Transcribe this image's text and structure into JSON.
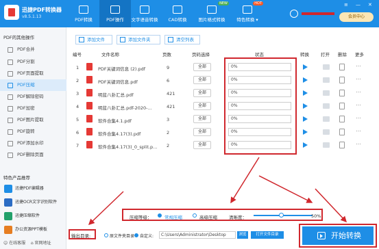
{
  "app": {
    "title": "迅捷PDF转换器",
    "version": "v8.5.1.13"
  },
  "tabs": [
    {
      "label": "PDF转换",
      "icon": "pdf-convert-icon",
      "active": false
    },
    {
      "label": "PDF操作",
      "icon": "pdf-operate-icon",
      "active": true
    },
    {
      "label": "文字语音转换",
      "icon": "text-voice-icon",
      "active": false
    },
    {
      "label": "CAD转换",
      "icon": "cad-icon",
      "active": false
    },
    {
      "label": "图片格式转换",
      "icon": "image-format-icon",
      "active": false,
      "badge": "NEW"
    },
    {
      "label": "特色转换",
      "icon": "feature-icon",
      "active": false,
      "badge": "HOT"
    }
  ],
  "header": {
    "member_label": "会员中心"
  },
  "sidebar": {
    "heading": "PDF的其他操作",
    "items": [
      {
        "label": "PDF合并"
      },
      {
        "label": "PDF分割"
      },
      {
        "label": "PDF页面提取"
      },
      {
        "label": "PDF压缩",
        "active": true
      },
      {
        "label": "PDF解除密码"
      },
      {
        "label": "PDF加密"
      },
      {
        "label": "PDF图片提取"
      },
      {
        "label": "PDF旋转"
      },
      {
        "label": "PDF添加水印"
      },
      {
        "label": "PDF删除页面"
      }
    ],
    "products_heading": "特色产品推荐",
    "products": [
      {
        "label": "迅捷PDF编辑器",
        "color": "#1e8ee6"
      },
      {
        "label": "迅捷OCR文字识别软件",
        "color": "#2b6cc4"
      },
      {
        "label": "迅捷压缩软件",
        "color": "#22a06b"
      },
      {
        "label": "办公资源PPT模板",
        "color": "#e67e22"
      }
    ],
    "online_service": "在线客服",
    "website": "官网地址"
  },
  "toolbar": {
    "add_file": "添加文件",
    "add_folder": "添加文件夹",
    "clear_list": "清空列表"
  },
  "table": {
    "headers": [
      "编号",
      "文件名称",
      "页数",
      "页码选择",
      "状态",
      "转换",
      "打开",
      "删除",
      "更多"
    ],
    "rows": [
      {
        "idx": "1",
        "name": "PDF关键词信息 (2).pdf",
        "pages": "9",
        "range": "全部",
        "status": "0%"
      },
      {
        "idx": "2",
        "name": "PDF关键词信息.pdf",
        "pages": "6",
        "range": "全部",
        "status": "0%"
      },
      {
        "idx": "3",
        "name": "明蓝八卦汇总.pdf",
        "pages": "421",
        "range": "全部",
        "status": "0%"
      },
      {
        "idx": "4",
        "name": "明蓝八卦汇总.pdf-2020-...",
        "pages": "421",
        "range": "全部",
        "status": "0%"
      },
      {
        "idx": "5",
        "name": "软件合集4.1.pdf",
        "pages": "3",
        "range": "全部",
        "status": "0%"
      },
      {
        "idx": "6",
        "name": "软件合集4.17(3).pdf",
        "pages": "2",
        "range": "全部",
        "status": "0%"
      },
      {
        "idx": "7",
        "name": "软件合集4.17(3)_0_split.p...",
        "pages": "2",
        "range": "全部",
        "status": "0%"
      }
    ]
  },
  "compression": {
    "level_label": "压缩等级：",
    "normal": "常规压缩",
    "high": "高级压缩",
    "clarity_label": "清晰度：",
    "clarity_value": "50%",
    "clarity_fraction": 0.5
  },
  "output": {
    "label": "输出目录:",
    "original": "原文件夹目录",
    "custom": "自定义:",
    "path": "C:\\Users\\Administrator\\Desktop",
    "browse": "浏览",
    "open": "打开文件目录"
  },
  "start_button": "开始转换",
  "colors": {
    "primary": "#1e8ee6",
    "highlight": "#d0272d"
  }
}
